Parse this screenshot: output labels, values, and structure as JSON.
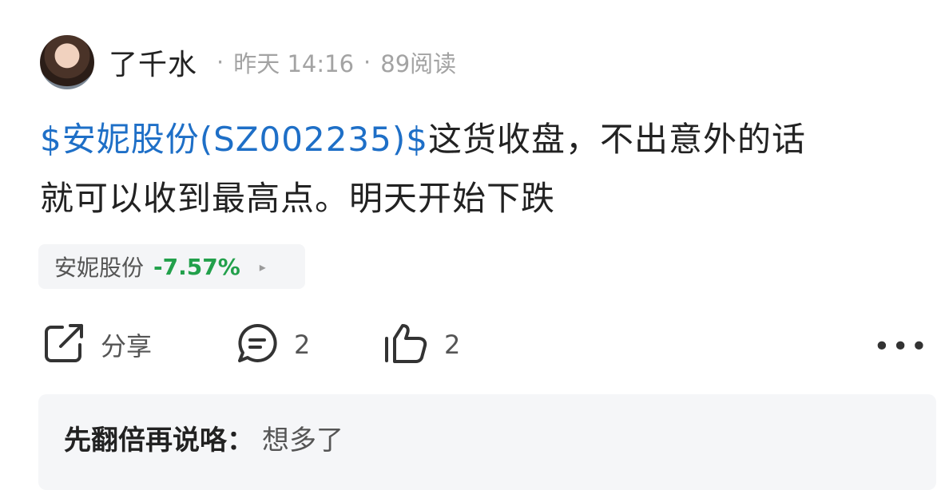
{
  "post": {
    "username": "了千水",
    "time": "昨天 14:16",
    "reads": "89阅读",
    "separator": "·",
    "stock_tag": "$安妮股份(SZ002235)$",
    "text_line1": "这货收盘，不出意外的话",
    "text_line2": "就可以收到最高点。明天开始下跌"
  },
  "stock_chip": {
    "name": "安妮股份",
    "change": "-7.57%",
    "change_color": "#22a04b",
    "arrow": "▸"
  },
  "actions": {
    "share_label": "分享",
    "comment_count": "2",
    "like_count": "2",
    "more": "•••"
  },
  "comment": {
    "author": "先翻倍再说咯：",
    "text": "想多了"
  },
  "colors": {
    "link": "#1e6fc7",
    "meta": "#a3a3a3"
  }
}
